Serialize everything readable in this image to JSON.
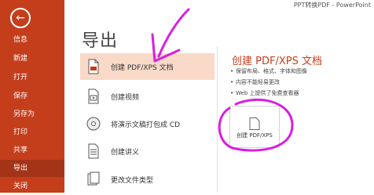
{
  "app_title": "PPT转换PDF - PowerPoint",
  "sidebar": {
    "items": [
      {
        "label": "信息"
      },
      {
        "label": "新建"
      },
      {
        "label": "打开"
      },
      {
        "label": "保存"
      },
      {
        "label": "另存为"
      },
      {
        "label": "打印"
      },
      {
        "label": "共享"
      },
      {
        "label": "导出",
        "active": true
      },
      {
        "label": "关闭"
      }
    ]
  },
  "main": {
    "title": "导出",
    "options": [
      {
        "label": "创建 PDF/XPS 文档",
        "icon": "pdf-document-icon",
        "selected": true
      },
      {
        "label": "创建视频",
        "icon": "video-icon"
      },
      {
        "label": "将演示文稿打包成 CD",
        "icon": "cd-icon"
      },
      {
        "label": "创建讲义",
        "icon": "handout-icon"
      },
      {
        "label": "更改文件类型",
        "icon": "file-type-icon"
      }
    ]
  },
  "detail": {
    "title": "创建 PDF/XPS 文档",
    "bullets": [
      "保留布局、格式、字体和图像",
      "内容不能轻易更改",
      "Web 上提供了免费查看器"
    ],
    "button_label": "创建 PDF/XPS"
  },
  "colors": {
    "sidebar": "#c43e1c",
    "selected_option": "#f9d9c8",
    "annotation": "#d81ee0"
  }
}
